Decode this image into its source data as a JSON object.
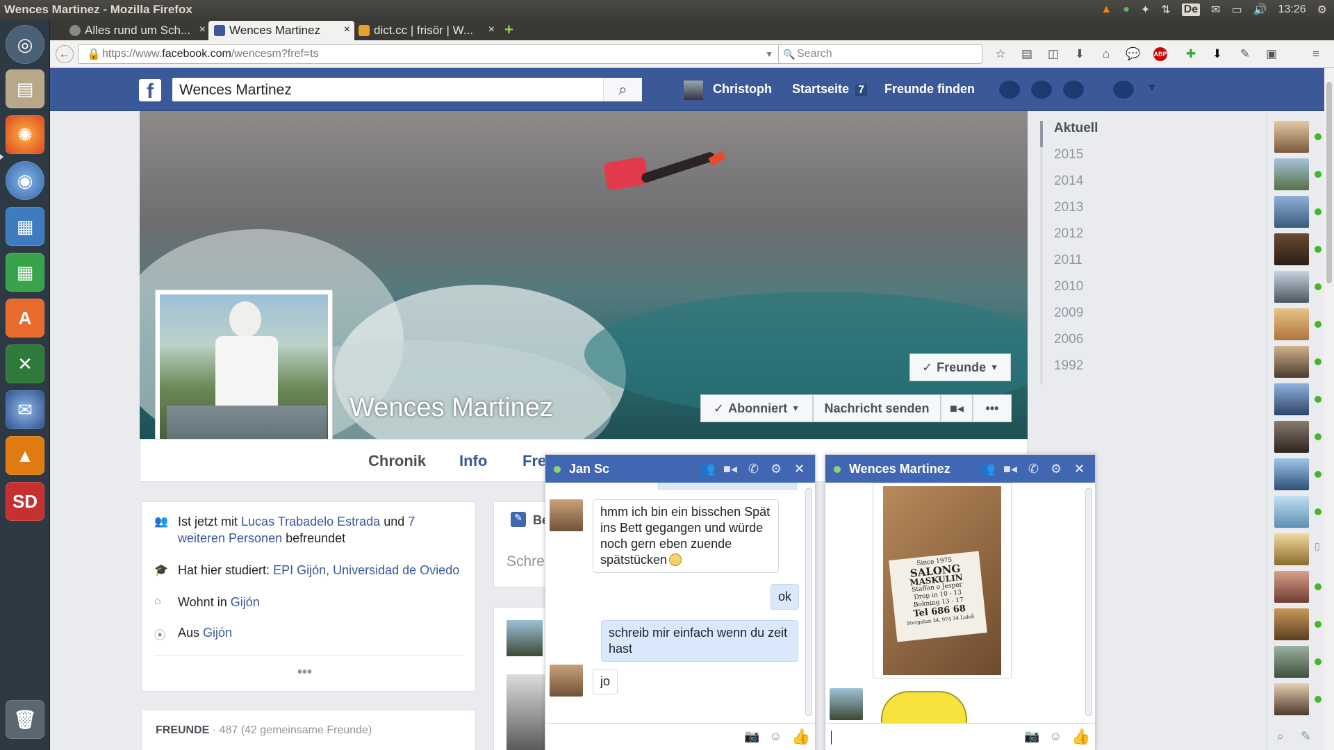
{
  "os": {
    "window_title": "Wences Martinez - Mozilla Firefox",
    "clock": "13:26",
    "keyboard_layout": "De"
  },
  "browser": {
    "tabs": [
      {
        "label": "Alles rund um Sch...",
        "active": false
      },
      {
        "label": "Wences Martinez",
        "active": true
      },
      {
        "label": "dict.cc | frisör | W...",
        "active": false
      }
    ],
    "url_prefix": "https://www.",
    "url_domain": "facebook.com",
    "url_path": "/wencesm?fref=ts",
    "search_placeholder": "Search"
  },
  "fb_header": {
    "search_value": "Wences Martinez",
    "user_name": "Christoph",
    "home_label": "Startseite",
    "home_count": "7",
    "find_friends": "Freunde finden"
  },
  "profile": {
    "name": "Wences Martinez",
    "friends_button": "Freunde",
    "subscribed_button": "Abonniert",
    "message_button": "Nachricht senden",
    "more_button": "•••"
  },
  "timeline_tabs": [
    "Chronik",
    "Info",
    "Fre"
  ],
  "years": [
    "Aktuell",
    "2015",
    "2014",
    "2013",
    "2012",
    "2011",
    "2010",
    "2009",
    "2006",
    "1992"
  ],
  "intro": {
    "friends_prefix": "Ist jetzt mit",
    "friends_link": "Lucas Trabadelo Estrada",
    "friends_and": "und",
    "friends_more_a": "7",
    "friends_more_b": "weiteren Personen",
    "friends_suffix": "befreundet",
    "studied_prefix": "Hat hier studiert:",
    "studied_link": "EPI Gijón, Universidad de Oviedo",
    "lives_prefix": "Wohnt in",
    "lives_link": "Gijón",
    "from_prefix": "Aus",
    "from_link": "Gijón",
    "more": "•••"
  },
  "friends_box": {
    "title": "FREUNDE",
    "count": "· 487 (42 gemeinsame Freunde)"
  },
  "composer": {
    "tab_label": "Be",
    "placeholder": "Schre"
  },
  "chat1": {
    "name": "Jan Sc",
    "messages": [
      {
        "from": "in",
        "text": "hmm ich bin ein bisschen Spät ins Bett gegangen und würde noch gern eben zuende spätstücken"
      },
      {
        "from": "out",
        "text": "ok"
      },
      {
        "from": "out",
        "text": "schreib mir einfach wenn du zeit hast"
      },
      {
        "from": "in",
        "text": "jo"
      }
    ]
  },
  "chat2": {
    "name": "Wences Martinez",
    "card_lines": [
      "Since 1975",
      "SALONG",
      "MASKULIN",
      "Staffan o Jesper",
      "Drop in 10 - 13",
      "Bokning 13 - 17",
      "Tel 686 68",
      "Storgatan 34, 974 34 Luleå"
    ]
  },
  "colors": {
    "fb_blue": "#3b5998",
    "chat_blue": "#4267b2",
    "online_green": "#42b72a"
  }
}
